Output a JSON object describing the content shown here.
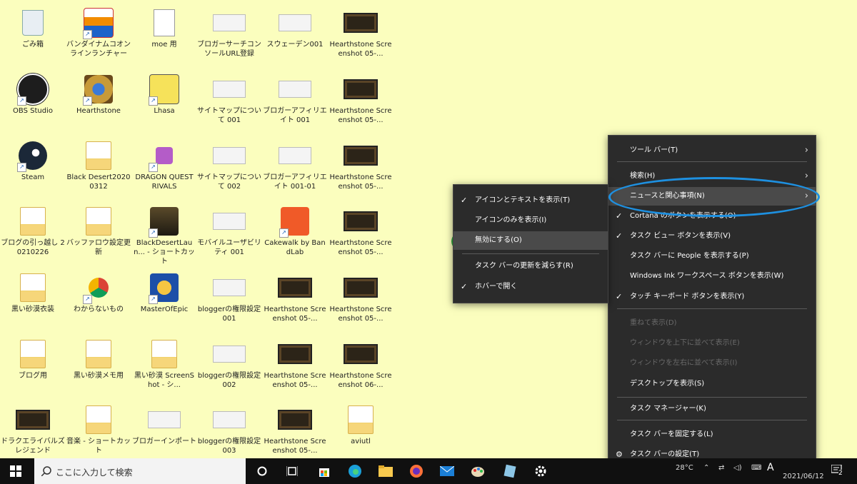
{
  "desktop": {
    "icons": [
      {
        "label": "ごみ箱",
        "kind": "bin"
      },
      {
        "label": "バンダイナムコオンラインランチャー",
        "kind": "bandai"
      },
      {
        "label": "moe 用",
        "kind": "doc"
      },
      {
        "label": "ブロガーサーチコンソールURL登録",
        "kind": "thumb"
      },
      {
        "label": "スウェーデン001",
        "kind": "thumb"
      },
      {
        "label": "Hearthstone Screenshot 05-...",
        "kind": "thumb-dark"
      },
      {
        "label": "OBS Studio",
        "kind": "obs"
      },
      {
        "label": "Hearthstone",
        "kind": "hearthstone"
      },
      {
        "label": "Lhasa",
        "kind": "lhasa"
      },
      {
        "label": "サイトマップについて 001",
        "kind": "thumb"
      },
      {
        "label": "ブロガーアフィリエイト 001",
        "kind": "thumb"
      },
      {
        "label": "Hearthstone Screenshot 05-...",
        "kind": "thumb-dark"
      },
      {
        "label": "Steam",
        "kind": "steam"
      },
      {
        "label": "Black Desert20200312",
        "kind": "folder"
      },
      {
        "label": "DRAGON QUEST RIVALS",
        "kind": "dq"
      },
      {
        "label": "サイトマップについて 002",
        "kind": "thumb"
      },
      {
        "label": "ブロガーアフィリエイト 001-01",
        "kind": "thumb"
      },
      {
        "label": "Hearthstone Screenshot 05-...",
        "kind": "thumb-dark"
      },
      {
        "label": "ブログの引っ越し 20210226",
        "kind": "folder"
      },
      {
        "label": "バッファロウ設定更新",
        "kind": "folder"
      },
      {
        "label": "BlackDesertLaun... - ショートカット",
        "kind": "bdo"
      },
      {
        "label": "モバイルユーザビリティ 001",
        "kind": "thumb"
      },
      {
        "label": "Cakewalk by BandLab",
        "kind": "cakewalk"
      },
      {
        "label": "Hearthstone Screenshot 05-...",
        "kind": "thumb-dark"
      },
      {
        "label": "黒い砂漠衣装",
        "kind": "folder"
      },
      {
        "label": "わからないもの",
        "kind": "chrome"
      },
      {
        "label": "MasterOfEpic",
        "kind": "moe"
      },
      {
        "label": "bloggerの権限設定 001",
        "kind": "thumb"
      },
      {
        "label": "Hearthstone Screenshot 05-...",
        "kind": "thumb-dark"
      },
      {
        "label": "Hearthstone Screenshot 05-...",
        "kind": "thumb-dark"
      },
      {
        "label": "ブログ用",
        "kind": "folder"
      },
      {
        "label": "黒い砂漠メモ用",
        "kind": "folder"
      },
      {
        "label": "黒い砂漠 ScreenShot - シ...",
        "kind": "folder"
      },
      {
        "label": "bloggerの権限設定 002",
        "kind": "thumb"
      },
      {
        "label": "Hearthstone Screenshot 05-...",
        "kind": "thumb-dark"
      },
      {
        "label": "Hearthstone Screenshot 06-...",
        "kind": "thumb-dark"
      },
      {
        "label": "ドラクエライバルズレジェンド",
        "kind": "thumb-dark"
      },
      {
        "label": "音楽 - ショートカット",
        "kind": "folder"
      },
      {
        "label": "ブロガーインポート",
        "kind": "thumb"
      },
      {
        "label": "bloggerの権限設定 003",
        "kind": "thumb"
      },
      {
        "label": "Hearthstone Screenshot 05-...",
        "kind": "thumb-dark"
      },
      {
        "label": "aviutl",
        "kind": "folder"
      }
    ]
  },
  "main_menu": {
    "items": [
      {
        "label": "ツール バー(T)",
        "arrow": true
      },
      {
        "label": "検索(H)",
        "arrow": true
      },
      {
        "label": "ニュースと関心事項(N)",
        "arrow": true,
        "highlighted": true
      },
      {
        "label": "Cortana のボタンを表示する(O)",
        "checked": true
      },
      {
        "label": "タスク ビュー ボタンを表示(V)",
        "checked": true
      },
      {
        "label": "タスク バーに People を表示する(P)"
      },
      {
        "label": "Windows Ink ワークスペース ボタンを表示(W)"
      },
      {
        "label": "タッチ キーボード ボタンを表示(Y)",
        "checked": true
      },
      {
        "label": "重ねて表示(D)",
        "disabled": true
      },
      {
        "label": "ウィンドウを上下に並べて表示(E)",
        "disabled": true
      },
      {
        "label": "ウィンドウを左右に並べて表示(I)",
        "disabled": true
      },
      {
        "label": "デスクトップを表示(S)"
      },
      {
        "label": "タスク マネージャー(K)"
      },
      {
        "label": "タスク バーを固定する(L)"
      },
      {
        "label": "タスク バーの設定(T)",
        "gear": true
      }
    ]
  },
  "sub_menu": {
    "items": [
      {
        "label": "アイコンとテキストを表示(T)",
        "checked": true
      },
      {
        "label": "アイコンのみを表示(I)"
      },
      {
        "label": "無効にする(O)",
        "highlighted": true
      },
      {
        "label": "タスク バーの更新を減らす(R)"
      },
      {
        "label": "ホバーで開く",
        "checked": true
      }
    ]
  },
  "taskbar": {
    "search_placeholder": "ここに入力して検索",
    "temperature": "28°C",
    "ime": "A",
    "date": "2021/06/12",
    "notification_count": "2"
  },
  "colors": {
    "desktop_bg": "#fbfebe",
    "menu_bg": "#2b2b2b",
    "blue_ring": "#1e90e0",
    "green_ring": "#2eaa3a"
  }
}
